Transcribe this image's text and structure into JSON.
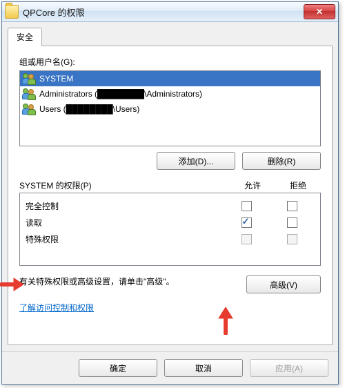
{
  "window": {
    "title": "QPCore 的权限",
    "close_label": "×"
  },
  "tab": {
    "security": "安全"
  },
  "groups": {
    "label": "组或用户名(G):",
    "items": [
      {
        "name": "SYSTEM",
        "selected": true
      },
      {
        "name": "Administrators (████████\\Administrators)",
        "selected": false
      },
      {
        "name": "Users (████████\\Users)",
        "selected": false
      }
    ]
  },
  "buttons": {
    "add": "添加(D)...",
    "remove": "删除(R)",
    "advanced": "高级(V)",
    "ok": "确定",
    "cancel": "取消",
    "apply": "应用(A)"
  },
  "permissions": {
    "header_label": "SYSTEM 的权限(P)",
    "allow": "允许",
    "deny": "拒绝",
    "rows": [
      {
        "name": "完全控制",
        "allow": false,
        "deny": false,
        "allow_disabled": false,
        "deny_disabled": false
      },
      {
        "name": "读取",
        "allow": true,
        "deny": false,
        "allow_disabled": false,
        "deny_disabled": false
      },
      {
        "name": "特殊权限",
        "allow": false,
        "deny": false,
        "allow_disabled": true,
        "deny_disabled": true
      }
    ]
  },
  "advanced_text": "有关特殊权限或高级设置，请单击\"高级\"。",
  "link_text": "了解访问控制和权限"
}
